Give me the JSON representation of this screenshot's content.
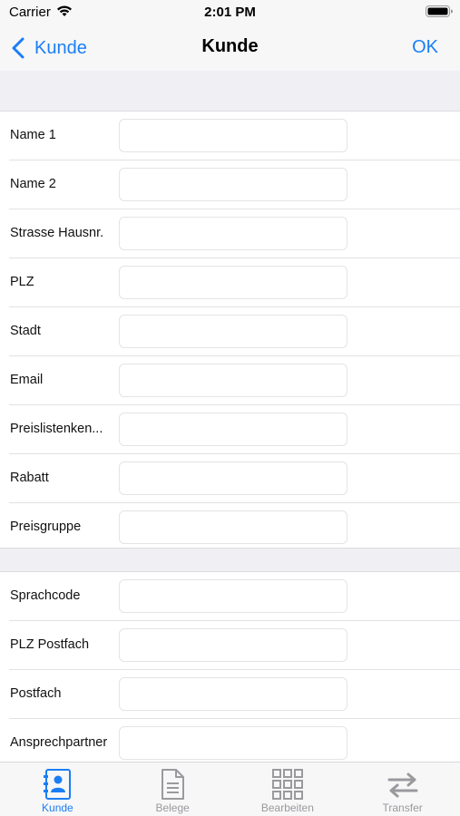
{
  "status_bar": {
    "carrier": "Carrier",
    "time": "2:01 PM"
  },
  "nav": {
    "back_label": "Kunde",
    "title": "Kunde",
    "ok_label": "OK"
  },
  "form": {
    "section1": [
      {
        "label": "Name 1",
        "value": ""
      },
      {
        "label": "Name 2",
        "value": ""
      },
      {
        "label": "Strasse Hausnr.",
        "value": ""
      },
      {
        "label": "PLZ",
        "value": ""
      },
      {
        "label": "Stadt",
        "value": ""
      },
      {
        "label": "Email",
        "value": ""
      },
      {
        "label": "Preislistenken...",
        "value": ""
      },
      {
        "label": "Rabatt",
        "value": ""
      },
      {
        "label": "Preisgruppe",
        "value": ""
      }
    ],
    "section2": [
      {
        "label": "Sprachcode",
        "value": ""
      },
      {
        "label": "PLZ Postfach",
        "value": ""
      },
      {
        "label": "Postfach",
        "value": ""
      },
      {
        "label": "Ansprechpartner",
        "value": ""
      }
    ]
  },
  "tabs": [
    {
      "label": "Kunde",
      "icon": "contact-card-icon",
      "active": true
    },
    {
      "label": "Belege",
      "icon": "document-icon",
      "active": false
    },
    {
      "label": "Bearbeiten",
      "icon": "grid-icon",
      "active": false
    },
    {
      "label": "Transfer",
      "icon": "transfer-arrows-icon",
      "active": false
    }
  ],
  "colors": {
    "accent": "#1a7ef5",
    "inactive": "#9a9a9e"
  }
}
